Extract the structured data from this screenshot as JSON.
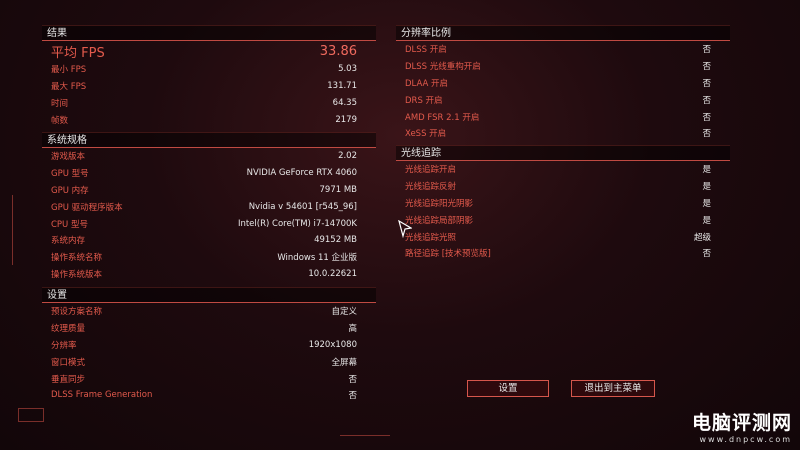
{
  "results": {
    "header": "结果",
    "rows": [
      {
        "label": "平均 FPS",
        "value": "33.86"
      },
      {
        "label": "最小 FPS",
        "value": "5.03"
      },
      {
        "label": "最大 FPS",
        "value": "131.71"
      },
      {
        "label": "时间",
        "value": "64.35"
      },
      {
        "label": "帧数",
        "value": "2179"
      }
    ]
  },
  "system": {
    "header": "系统规格",
    "rows": [
      {
        "label": "游戏版本",
        "value": "2.02"
      },
      {
        "label": "GPU 型号",
        "value": "NVIDIA GeForce RTX 4060"
      },
      {
        "label": "GPU 内存",
        "value": "7971 MB"
      },
      {
        "label": "GPU 驱动程序版本",
        "value": "Nvidia v 54601 [r545_96]"
      },
      {
        "label": "CPU 型号",
        "value": "Intel(R) Core(TM) i7-14700K"
      },
      {
        "label": "系统内存",
        "value": "49152 MB"
      },
      {
        "label": "操作系统名称",
        "value": "Windows 11 企业版"
      },
      {
        "label": "操作系统版本",
        "value": "10.0.22621"
      }
    ]
  },
  "settings": {
    "header": "设置",
    "rows": [
      {
        "label": "预设方案名称",
        "value": "自定义"
      },
      {
        "label": "纹理质量",
        "value": "高"
      },
      {
        "label": "分辨率",
        "value": "1920x1080"
      },
      {
        "label": "窗口模式",
        "value": "全屏幕"
      },
      {
        "label": "垂直同步",
        "value": "否"
      },
      {
        "label": "DLSS Frame Generation",
        "value": "否"
      }
    ]
  },
  "resolution": {
    "header": "分辨率比例",
    "rows": [
      {
        "label": "DLSS 开启",
        "value": "否"
      },
      {
        "label": "DLSS 光线重构开启",
        "value": "否"
      },
      {
        "label": "DLAA 开启",
        "value": "否"
      },
      {
        "label": "DRS 开启",
        "value": "否"
      },
      {
        "label": "AMD FSR 2.1 开启",
        "value": "否"
      },
      {
        "label": "XeSS 开启",
        "value": "否"
      }
    ]
  },
  "raytracing": {
    "header": "光线追踪",
    "rows": [
      {
        "label": "光线追踪开启",
        "value": "是"
      },
      {
        "label": "光线追踪反射",
        "value": "是"
      },
      {
        "label": "光线追踪阳光阴影",
        "value": "是"
      },
      {
        "label": "光线追踪局部阴影",
        "value": "是"
      },
      {
        "label": "光线追踪光照",
        "value": "超级"
      },
      {
        "label": "路径追踪 [技术预览版]",
        "value": "否"
      }
    ]
  },
  "buttons": {
    "settings": "设置",
    "main_menu": "退出到主菜单"
  },
  "watermark": {
    "title": "电脑评测网",
    "url": "www.dnpcw.com"
  },
  "colors": {
    "accent": "#e8604e",
    "background": "#1e0a0e",
    "value_text": "#e8e8e8"
  }
}
